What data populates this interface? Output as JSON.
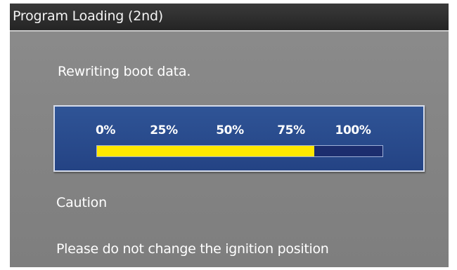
{
  "window": {
    "title": "Program Loading (2nd)"
  },
  "main": {
    "status_message": "Rewriting boot data.",
    "caution_label": "Caution",
    "warning_message": "Please do not change the ignition position"
  },
  "progress": {
    "tick_labels": [
      "0%",
      "25%",
      "50%",
      "75%",
      "100%"
    ],
    "value_percent": 76,
    "colors": {
      "panel": "#2f5496",
      "fill": "#ffe800",
      "track": "#1c2d6e"
    }
  }
}
